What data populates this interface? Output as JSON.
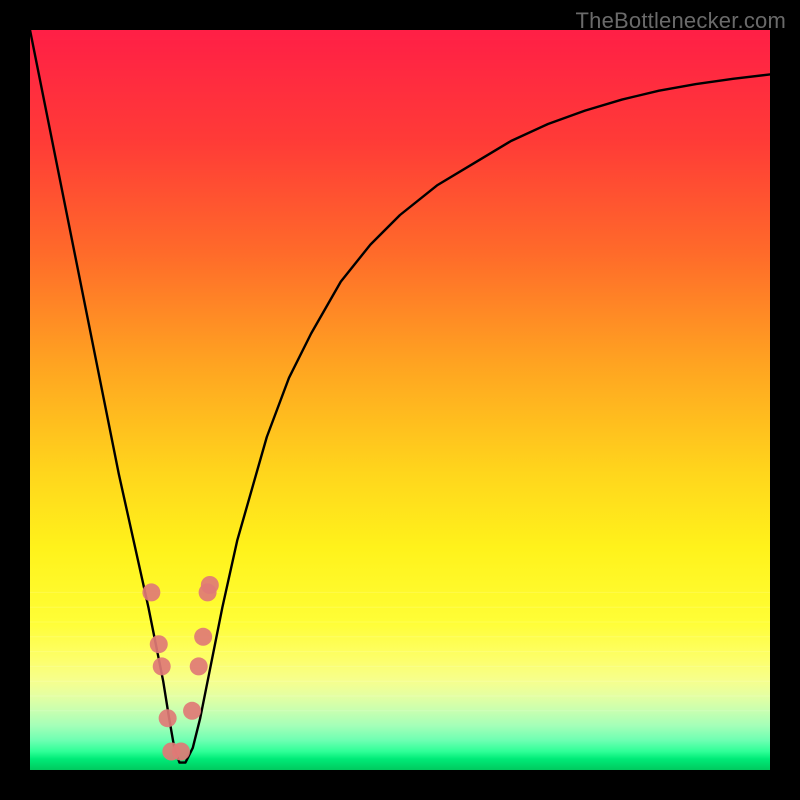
{
  "watermark": "TheBottlenecker.com",
  "chart_data": {
    "type": "line",
    "title": "",
    "xlabel": "",
    "ylabel": "",
    "xlim": [
      0,
      100
    ],
    "ylim": [
      0,
      100
    ],
    "series": [
      {
        "name": "curve",
        "x": [
          0,
          2,
          4,
          6,
          8,
          10,
          12,
          14,
          16,
          17,
          18,
          18.8,
          19.5,
          20.2,
          21,
          22,
          23,
          24,
          26,
          28,
          30,
          32,
          35,
          38,
          42,
          46,
          50,
          55,
          60,
          65,
          70,
          75,
          80,
          85,
          90,
          95,
          100
        ],
        "y": [
          100,
          90,
          80,
          70,
          60,
          50,
          40,
          31,
          22,
          17,
          12,
          7,
          3,
          1,
          1,
          3,
          7,
          12,
          22,
          31,
          38,
          45,
          53,
          59,
          66,
          71,
          75,
          79,
          82,
          85,
          87.3,
          89.1,
          90.6,
          91.8,
          92.7,
          93.4,
          94
        ]
      }
    ],
    "highlight_dots": {
      "x": [
        16.4,
        17.4,
        17.8,
        18.6,
        19.1,
        20.4,
        21.9,
        22.8,
        23.4,
        24.0,
        24.3
      ],
      "y": [
        24,
        17,
        14,
        7,
        2.5,
        2.5,
        8,
        14,
        18,
        24,
        25
      ]
    },
    "gradient_bands": [
      {
        "y": 100,
        "color": "#ff1f46"
      },
      {
        "y": 85,
        "color": "#ff3b37"
      },
      {
        "y": 70,
        "color": "#ff6a2a"
      },
      {
        "y": 55,
        "color": "#ffa321"
      },
      {
        "y": 40,
        "color": "#ffd61c"
      },
      {
        "y": 30,
        "color": "#fff21b"
      },
      {
        "y": 20,
        "color": "#fffe36"
      },
      {
        "y": 15,
        "color": "#fdff6a"
      },
      {
        "y": 12,
        "color": "#f6ff8e"
      },
      {
        "y": 10,
        "color": "#e4ffa2"
      },
      {
        "y": 8,
        "color": "#c8ffb0"
      },
      {
        "y": 6,
        "color": "#a4ffb8"
      },
      {
        "y": 4,
        "color": "#6dffb2"
      },
      {
        "y": 2.5,
        "color": "#2fff97"
      },
      {
        "y": 1.5,
        "color": "#00eb78"
      },
      {
        "y": 0,
        "color": "#00c95e"
      }
    ]
  }
}
